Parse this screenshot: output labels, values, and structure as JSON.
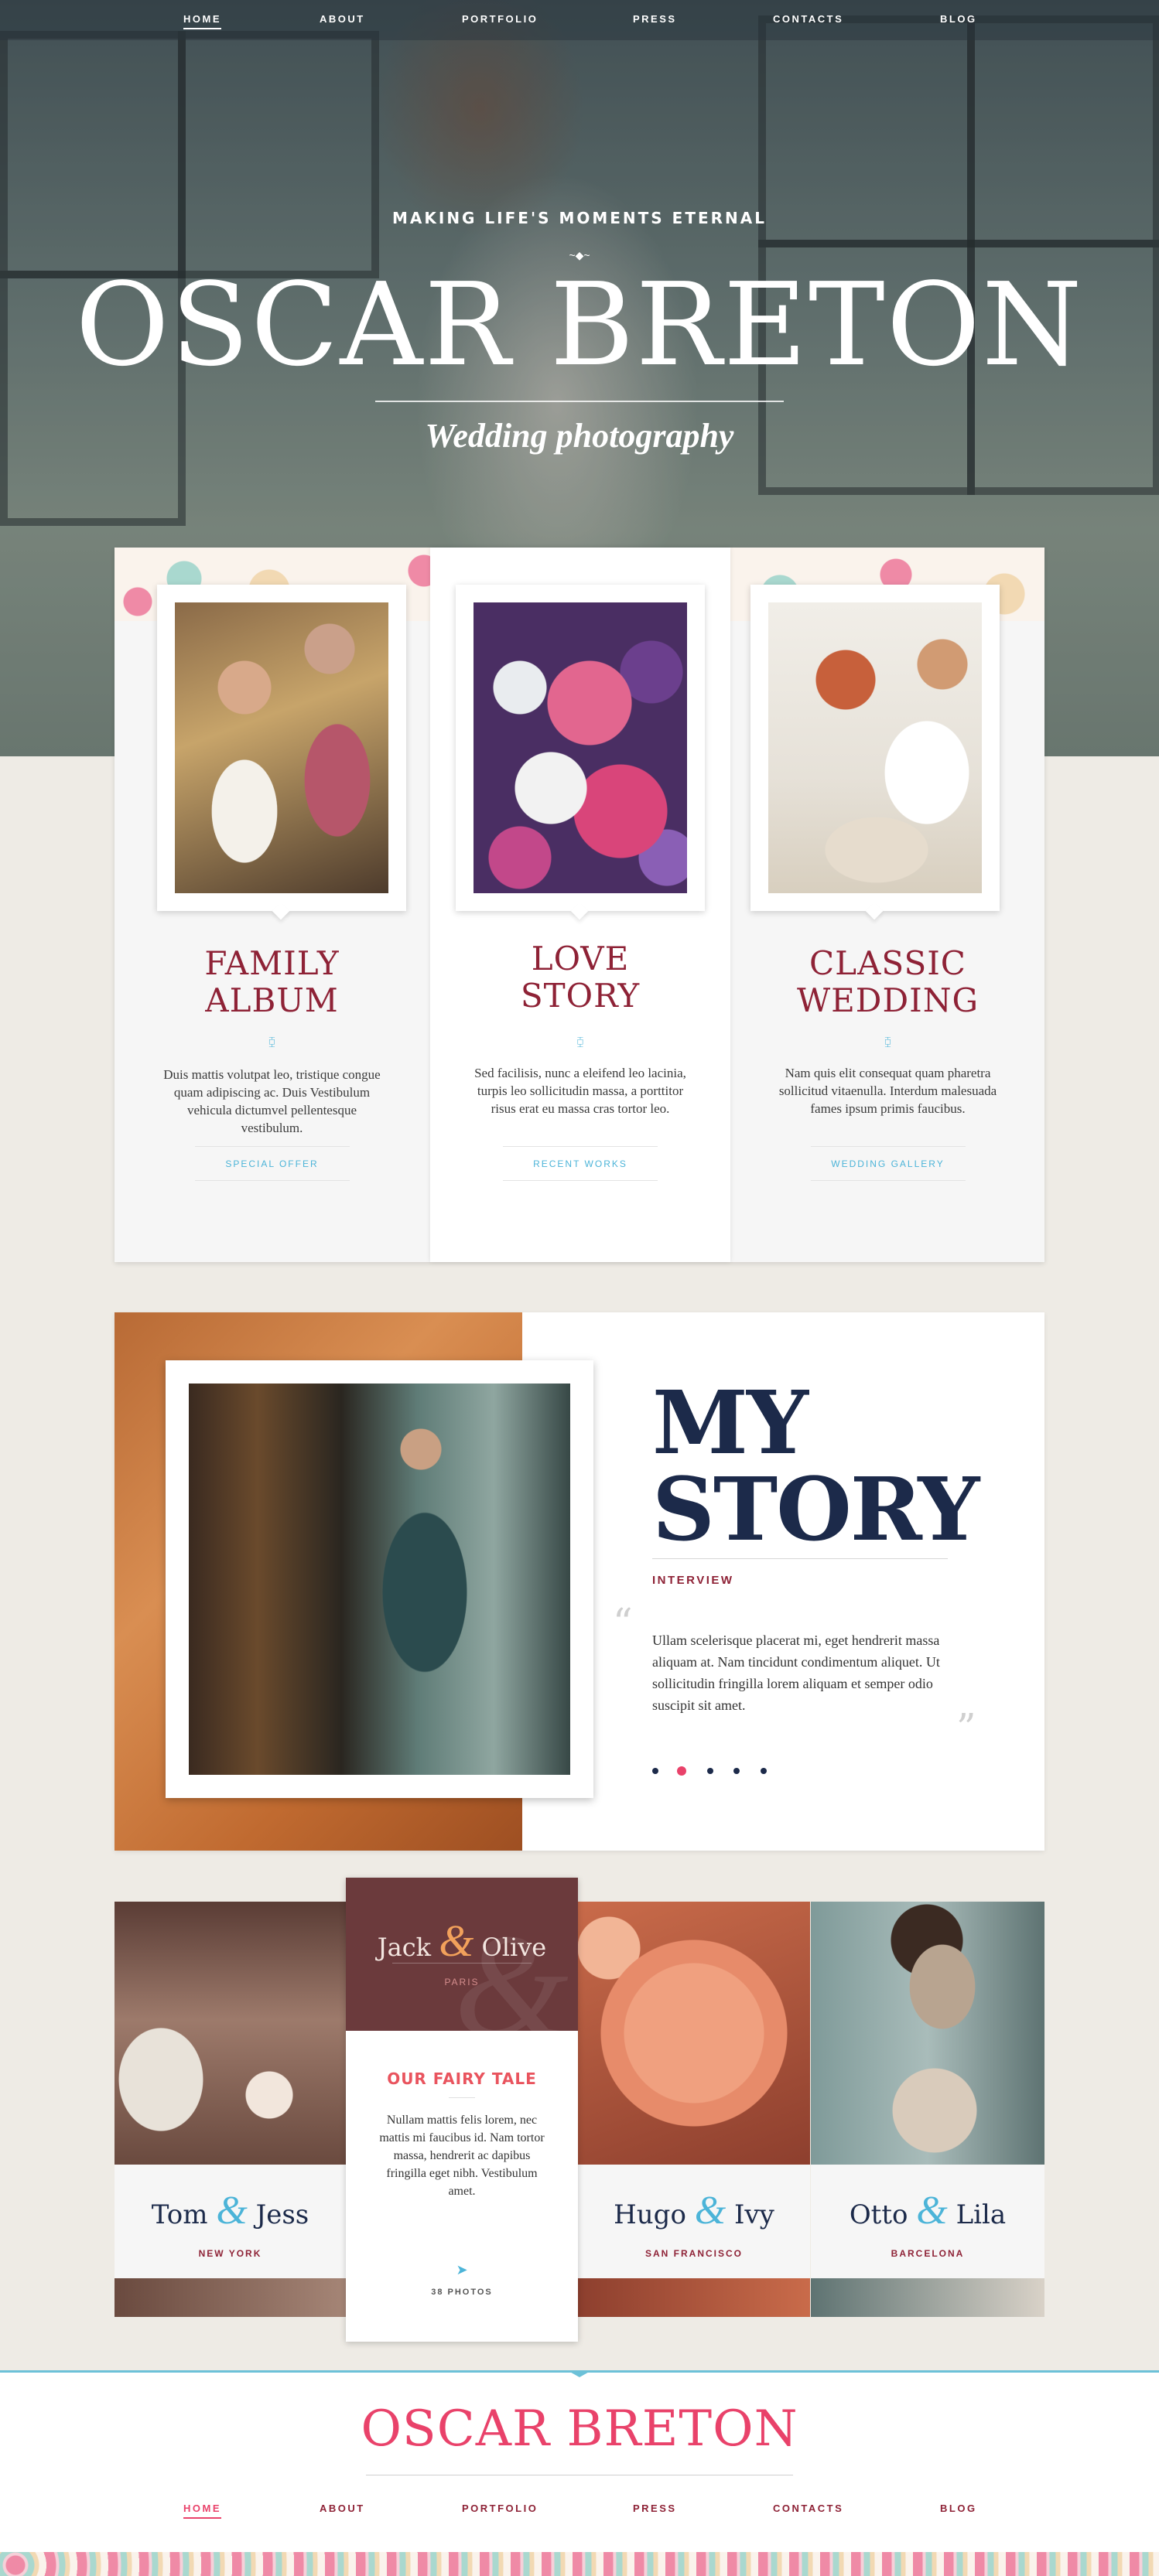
{
  "nav": {
    "items": [
      {
        "label": "HOME",
        "active": true
      },
      {
        "label": "ABOUT",
        "active": false
      },
      {
        "label": "PORTFOLIO",
        "active": false
      },
      {
        "label": "PRESS",
        "active": false
      },
      {
        "label": "CONTACTS",
        "active": false
      },
      {
        "label": "BLOG",
        "active": false
      }
    ]
  },
  "hero": {
    "tagline": "MAKING LIFE'S MOMENTS ETERNAL",
    "title": "OSCAR BRETON",
    "subtitle": "Wedding photography"
  },
  "services": [
    {
      "title_line1": "FAMILY",
      "title_line2": "ALBUM",
      "text": "Duis mattis volutpat leo, tristique congue quam adipiscing ac. Duis Vestibulum vehicula dictumvel pellentesque vestibulum.",
      "link": "SPECIAL OFFER"
    },
    {
      "title_line1": "LOVE",
      "title_line2": "STORY",
      "text": "Sed facilisis, nunc a eleifend leo lacinia, turpis leo sollicitudin massa, a porttitor risus erat eu massa cras tortor leo.",
      "link": "RECENT WORKS"
    },
    {
      "title_line1": "CLASSIC",
      "title_line2": "WEDDING",
      "text": "Nam quis elit consequat quam pharetra sollicitud vitaenulla. Interdum malesuada fames ipsum primis faucibus.",
      "link": "WEDDING GALLERY"
    }
  ],
  "story": {
    "title_line1": "MY",
    "title_line2": "STORY",
    "kicker": "INTERVIEW",
    "quote": "Ullam scelerisque placerat mi, eget hendrerit massa aliquam at. Nam tincidunt condimentum aliquet. Ut sollicitudin fringilla lorem aliquam et semper odio suscipit sit amet.",
    "slides": 5,
    "active_slide": 2
  },
  "couples": [
    {
      "first": "Tom",
      "second": "Jess",
      "city": "NEW YORK"
    },
    {
      "first": "Hugo",
      "second": "Ivy",
      "city": "SAN FRANCISCO"
    },
    {
      "first": "Otto",
      "second": "Lila",
      "city": "BARCELONA"
    }
  ],
  "featured_couple": {
    "first": "Jack",
    "second": "Olive",
    "city": "PARIS",
    "heading": "OUR FAIRY TALE",
    "text": "Nullam mattis felis lorem, nec mattis mi faucibus id. Nam tortor massa, hendrerit ac dapibus fringilla eget nibh. Vestibulum amet.",
    "photos": "38 PHOTOS"
  },
  "ampersand": "&",
  "footer": {
    "brand": "OSCAR BRETON",
    "nav": [
      {
        "label": "HOME",
        "active": true
      },
      {
        "label": "ABOUT",
        "active": false
      },
      {
        "label": "PORTFOLIO",
        "active": false
      },
      {
        "label": "PRESS",
        "active": false
      },
      {
        "label": "CONTACTS",
        "active": false
      },
      {
        "label": "BLOG",
        "active": false
      }
    ]
  },
  "icons": {
    "ornament": "swirl-ornament-icon",
    "bow": "bow-tie-icon",
    "quote": "quote-mark-icon",
    "plane": "paper-plane-icon"
  },
  "colors": {
    "burgundy": "#8e2236",
    "navy": "#1c2a4a",
    "pink": "#e9426a",
    "sky": "#4cb4d8",
    "feature_top": "#6b3a3c"
  }
}
